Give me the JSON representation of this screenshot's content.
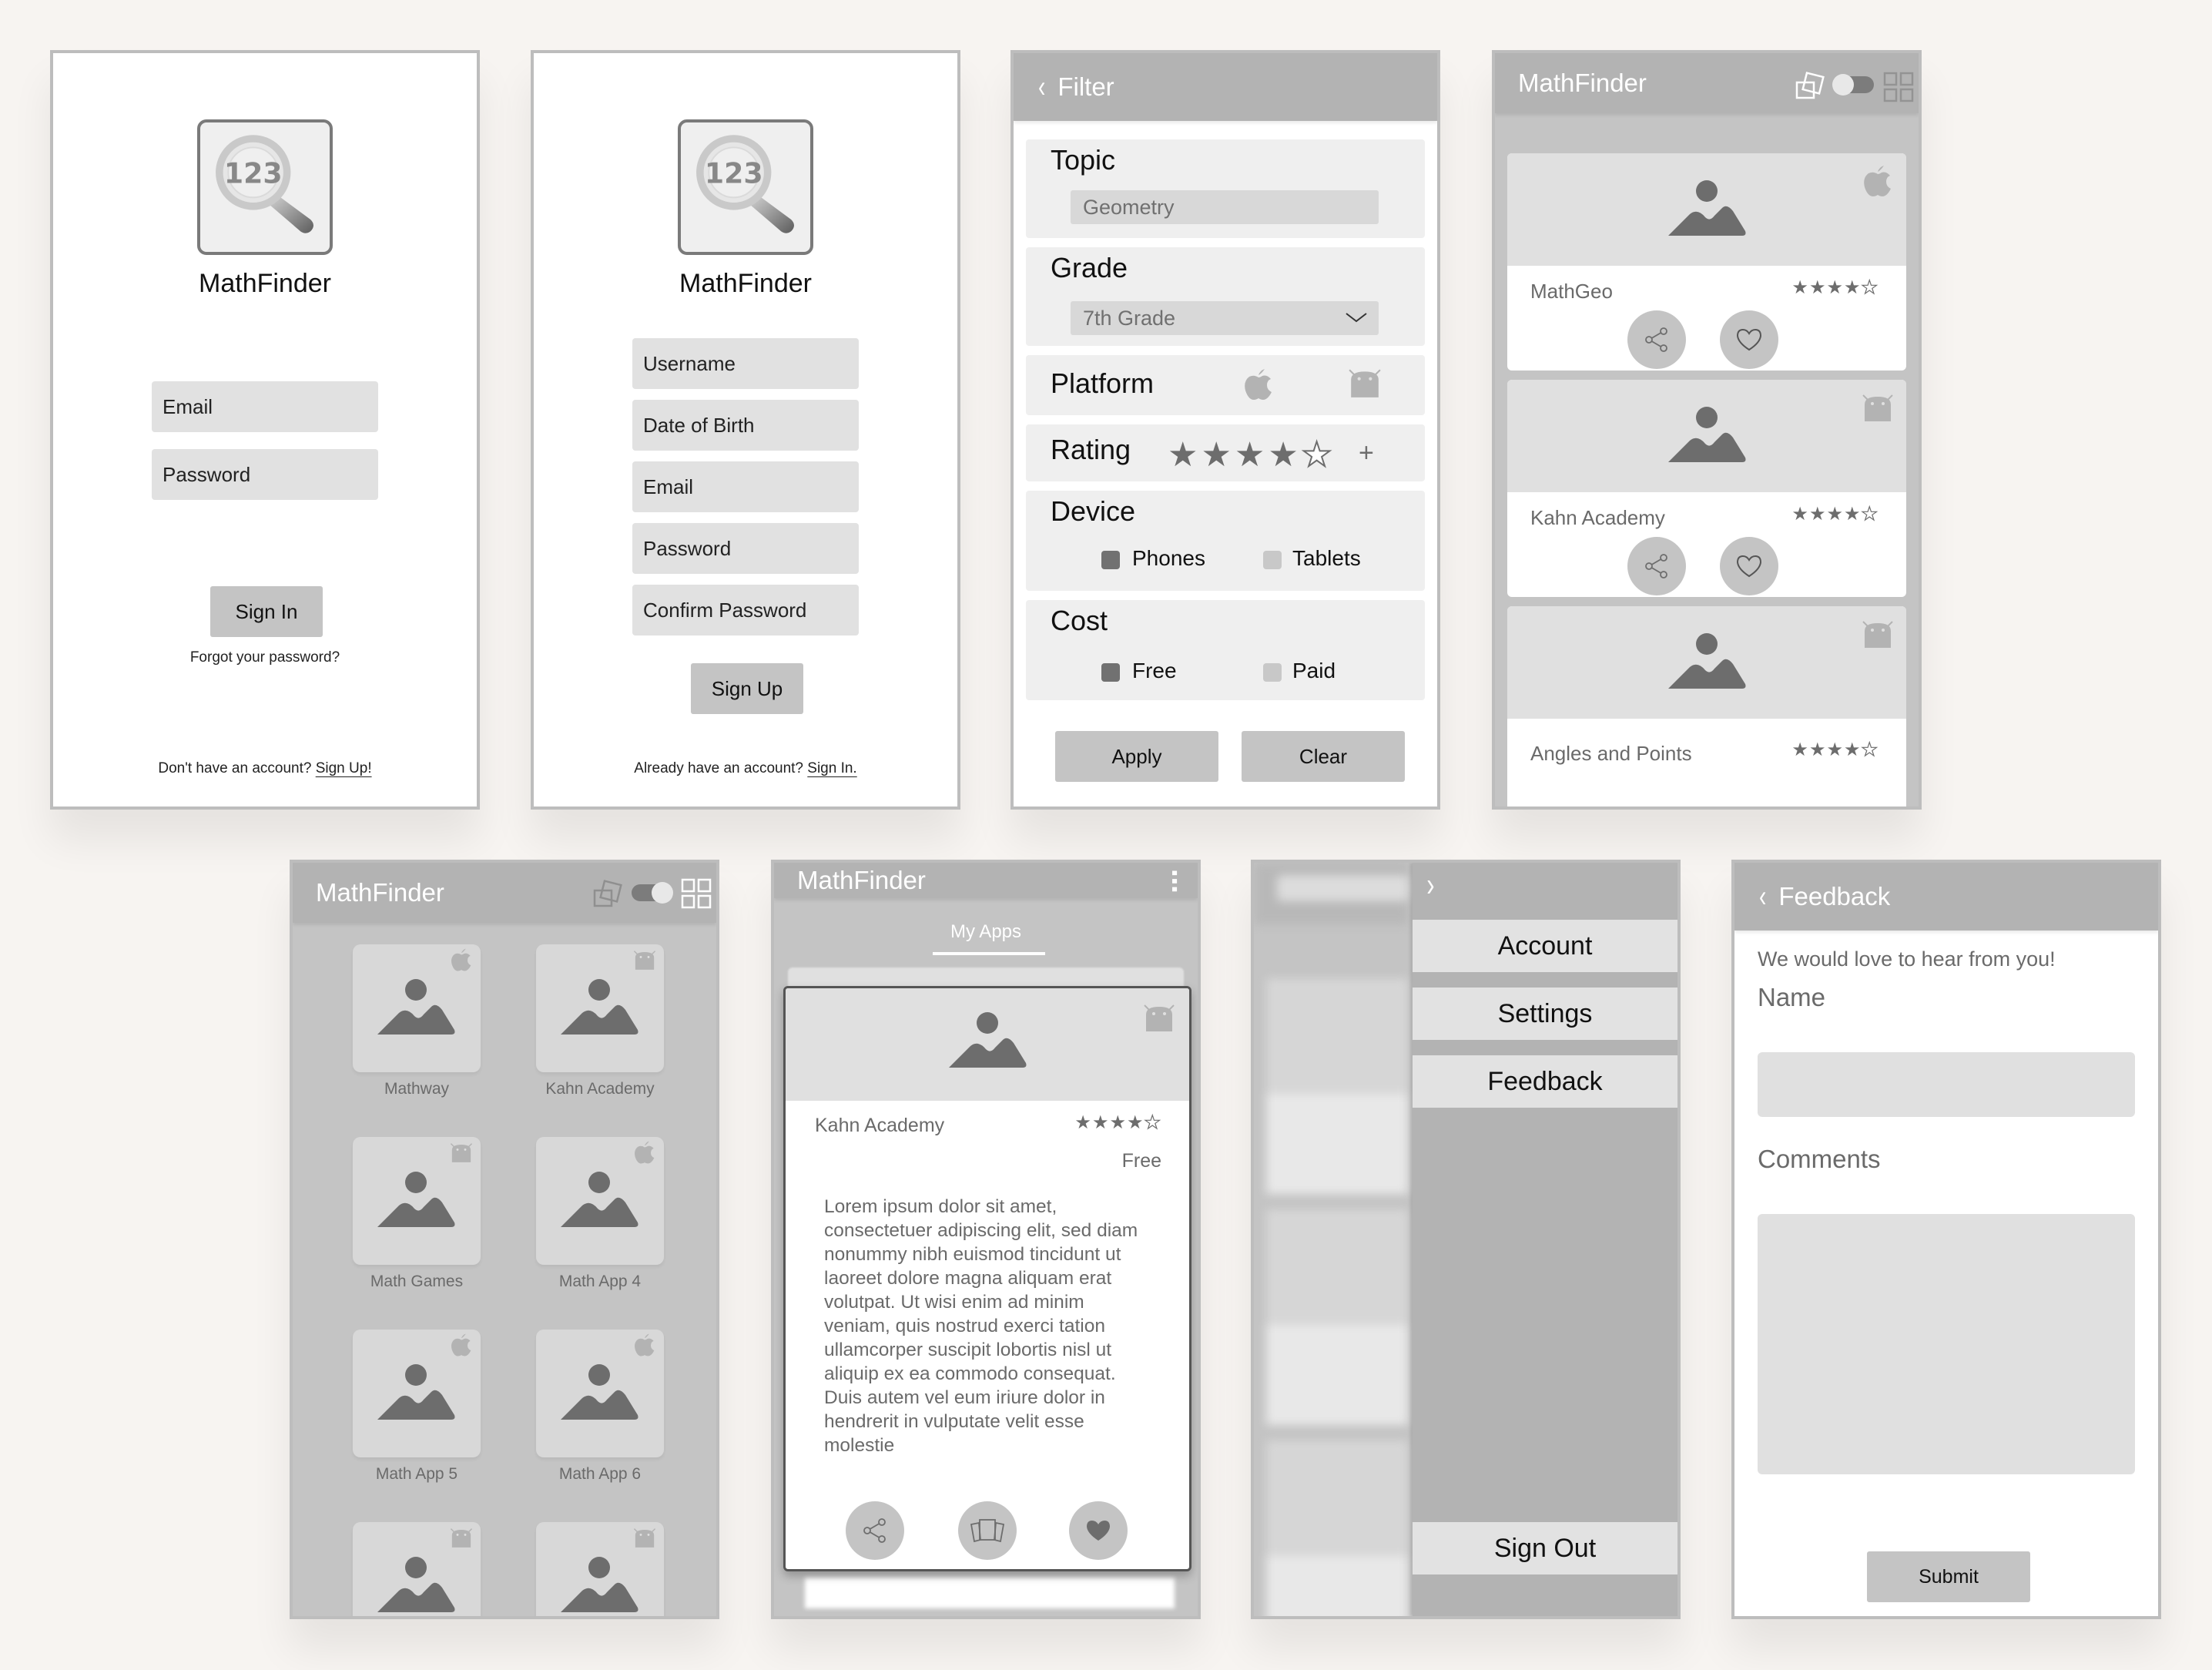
{
  "app_name": "MathFinder",
  "signin": {
    "logo_text": "123",
    "email_placeholder": "Email",
    "password_placeholder": "Password",
    "sign_in_label": "Sign In",
    "forgot_label": "Forgot your password?",
    "no_account_text": "Don't have an account?",
    "sign_up_link": "Sign Up!"
  },
  "signup": {
    "logo_text": "123",
    "username_placeholder": "Username",
    "dob_placeholder": "Date of Birth",
    "email_placeholder": "Email",
    "password_placeholder": "Password",
    "confirm_placeholder": "Confirm Password",
    "sign_up_label": "Sign Up",
    "have_account_text": "Already have an account?",
    "sign_in_link": "Sign In."
  },
  "filter": {
    "title": "Filter",
    "topic_label": "Topic",
    "topic_value": "Geometry",
    "grade_label": "Grade",
    "grade_value": "7th Grade",
    "platform_label": "Platform",
    "platforms": [
      "apple",
      "android"
    ],
    "rating_label": "Rating",
    "rating_value": 4,
    "rating_max": 5,
    "rating_plus": "+",
    "device_label": "Device",
    "device_options": [
      {
        "label": "Phones",
        "checked": true
      },
      {
        "label": "Tablets",
        "checked": false
      }
    ],
    "cost_label": "Cost",
    "cost_options": [
      {
        "label": "Free",
        "checked": true
      },
      {
        "label": "Paid",
        "checked": false
      }
    ],
    "apply_label": "Apply",
    "clear_label": "Clear"
  },
  "list_view": {
    "view_toggle": "list",
    "apps": [
      {
        "name": "MathGeo",
        "platform": "apple",
        "rating": 4
      },
      {
        "name": "Kahn Academy",
        "platform": "android",
        "rating": 4
      },
      {
        "name": "Angles and Points",
        "platform": "android",
        "rating": 4
      }
    ]
  },
  "grid_view": {
    "view_toggle": "grid",
    "apps": [
      {
        "name": "Mathway",
        "platform": "apple"
      },
      {
        "name": "Kahn Academy",
        "platform": "android"
      },
      {
        "name": "Math Games",
        "platform": "android"
      },
      {
        "name": "Math App 4",
        "platform": "apple"
      },
      {
        "name": "Math App 5",
        "platform": "apple"
      },
      {
        "name": "Math App 6",
        "platform": "apple"
      },
      {
        "name": "",
        "platform": "android"
      },
      {
        "name": "",
        "platform": "android"
      }
    ]
  },
  "detail": {
    "tab_label": "My Apps",
    "app_name": "Kahn Academy",
    "platform": "android",
    "rating": 4,
    "price": "Free",
    "description": "Lorem ipsum dolor sit amet, consectetuer adipiscing elit, sed diam nonummy nibh euismod tincidunt ut laoreet dolore magna aliquam erat volutpat. Ut wisi enim ad minim veniam, quis nostrud exerci tation ullamcorper suscipit lobortis nisl ut aliquip ex ea commodo consequat. Duis autem vel eum iriure dolor in hendrerit in vulputate velit esse molestie",
    "favorited": true
  },
  "menu": {
    "items": [
      "Account",
      "Settings",
      "Feedback"
    ],
    "sign_out_label": "Sign Out"
  },
  "feedback": {
    "title": "Feedback",
    "intro": "We would love to hear from you!",
    "name_label": "Name",
    "name_value": "",
    "comments_label": "Comments",
    "comments_value": "",
    "submit_label": "Submit"
  },
  "colors": {
    "background": "#f7f4f1",
    "appbar": "#b3b3b3",
    "field": "#e1e1e1",
    "button": "#c4c4c4",
    "icon_dark": "#6d6d6d"
  }
}
